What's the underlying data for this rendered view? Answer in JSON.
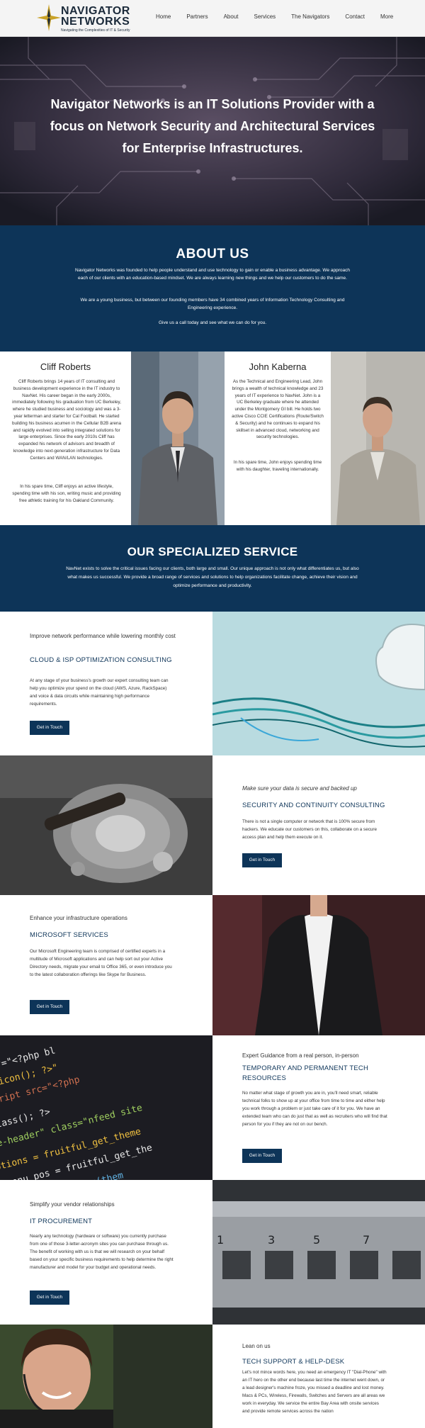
{
  "header": {
    "logo_line1": "NAVIGATOR",
    "logo_line2": "NETWORKS",
    "logo_tagline": "Navigating the Complexities of IT & Security",
    "nav": [
      "Home",
      "Partners",
      "About",
      "Services",
      "The Navigators",
      "Contact",
      "More"
    ]
  },
  "hero": {
    "headline": "Navigator Networks is an IT Solutions Provider with a focus on Network Security and Architectural Services for Enterprise Infrastructures."
  },
  "about": {
    "title": "ABOUT US",
    "p1": "Navigator Networks was founded to help people understand and use technology to gain or enable a business advantage. We approach each of our clients with an education-based mindset. We are always learning new things and we help our customers to do the same.",
    "p2": "We are a young business, but between our founding members have 34 combined years of Information Technology Consulting and Engineering experience.",
    "p3": "Give us a call today and see what we can do for you."
  },
  "team": {
    "cliff": {
      "name": "Cliff Roberts",
      "p1": "Cliff Roberts brings 14 years of IT consulting and business development experience in the IT industry to NavNet. His career began in the early 2000s, immediately following his graduation from UC Berkeley, where he studied business and sociology and was a 3-year letterman and starter for Cal Football. He started building his business acumen in the Cellular B2B arena and rapidly evolved into selling integrated solutions for large enterprises. Since the early 2010s Cliff has expanded his network of advisors and breadth of knowledge into next-generation infrastructure for Data Centers and WAN/LAN technologies.",
      "p2": "In his spare time, Cliff enjoys an active lifestyle, spending time with his son, writing music and providing free athletic training for his Oakland Community."
    },
    "john": {
      "name": "John Kaberna",
      "p1": "As the Technical and Engineering Lead, John brings a wealth of technical knowledge and 23 years of IT experience to NavNet. John is a UC Berkeley graduate where he attended under the Montgomery GI bill. He holds two active Cisco CCIE Certifications (Route/Switch & Security) and he continues to expand his skillset in advanced cloud, networking and security technologies.",
      "p2": "In his spare time, John enjoys spending time with his daughter, traveling internationally."
    }
  },
  "specialized": {
    "title": "OUR SPECIALIZED SERVICE",
    "text": "NavNet exists to solve the critical issues facing our clients, both large and small. Our unique approach is not only what differentiates us, but also what makes us successful. We provide a broad range of services and solutions to help organizations facilitate change, achieve their vision and optimize performance and productivity."
  },
  "services": [
    {
      "kicker": "Improve network performance while lowering monthly cost",
      "title": "CLOUD & ISP OPTIMIZATION CONSULTING",
      "desc": "At any stage of your business's growth our expert consulting team can help you optimize your spend on the cloud (AWS, Azure, RackSpace) and voice & data circuits while maintaining high performance requirements.",
      "button": "Get in Touch"
    },
    {
      "kicker": "Make sure your data is secure and backed up",
      "title": "SECURITY AND CONTINUITY CONSULTING",
      "desc": "There is not a single computer or network that is 100% secure from hackers. We educate our customers on this, collaborate on a secure access plan and help them execute on it.",
      "button": "Get in Touch"
    },
    {
      "kicker": "Enhance your infrastructure operations",
      "title": "MICROSOFT SERVICES",
      "desc": "Our Microsoft Engineering team is comprised of certified experts in a multitude of Microsoft applications and can help sort out your Active Directory needs, migrate your email to Office 365, or even introduce you to the latest collaboration offerings like Skype for Business.",
      "button": "Get in Touch"
    },
    {
      "kicker": "Expert Guidance from a real person, in-person",
      "title": "TEMPORARY AND PERMANENT TECH RESOURCES",
      "desc": "No matter what stage of growth you are in, you'll need smart, reliable technical folks to show up at your office from time to time and either help you work through a problem or just take care of it for you. We have an extended team who can do just that as well as recruiters who will find that person for you if they are not on our bench.",
      "button": "Get in Touch"
    },
    {
      "kicker": "Simplify your vendor relationships",
      "title": "IT PROCUREMENT",
      "desc": "Nearly any technology (hardware or software) you currently purchase from one of those 3-letter-acronym sites you can purchase through us. The benefit of working with us is that we will research on your behalf based on your specific business requirements to help determine the right manufacturer and model for your budget and operational needs.",
      "button": "Get in Touch"
    },
    {
      "kicker": "Lean on us",
      "title": "TECH SUPPORT & HELP-DESK",
      "desc": "Let's not mince words here, you need an emergency IT \"Dial-Phone\" with an IT hero on the other end because last time the internet went down, or a lead designer's machine froze, you missed a deadline and lost money. Macs & PCs, Wireless, Firewalls, Switches and Servers are all areas we work in everyday. We service the entire Bay Area with onsite services and provide remote services across the nation"
    }
  ],
  "code_lines": [
    "href=\"<?php bl",
    "_favicon(); ?>\"",
    "script src=\"<?php",
    "y_class(); ?>",
    "ge-header\" class=\"nfeed site",
    "options = fruitful_get_theme",
    "$menu_pos = fruitful_get_the",
    "options = esc_attr(them"
  ],
  "port_numbers": [
    "1",
    "3",
    "5",
    "7"
  ],
  "colors": {
    "navy": "#0d3458",
    "header_bg": "#f4f4f4"
  }
}
